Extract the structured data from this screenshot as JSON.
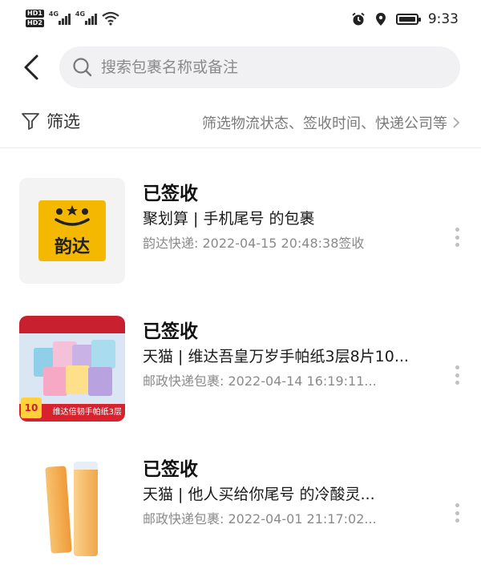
{
  "status_bar": {
    "hd1": "HD1",
    "hd2": "HD2",
    "net1": "4G",
    "net2": "4G",
    "time": "9:33",
    "battery_level": 0.85,
    "icons": [
      "alarm-icon",
      "location-icon",
      "battery-icon",
      "wifi-icon"
    ]
  },
  "search": {
    "placeholder": "搜索包裹名称或备注"
  },
  "filter": {
    "label": "筛选",
    "hint": "筛选物流状态、签收时间、快递公司等"
  },
  "packages": [
    {
      "status": "已签收",
      "description": "聚划算 | 手机尾号 的包裹",
      "meta": "韵达快递: 2022-04-15 20:48:38签收",
      "thumb_text": "韵达"
    },
    {
      "status": "已签收",
      "description": "天猫 | 维达吾皇万岁手帕纸3层8片10...",
      "meta": "邮政快递包裹: 2022-04-14 16:19:11...",
      "thumb_badge": "10",
      "thumb_banner": "维达倍韧手帕纸3层"
    },
    {
      "status": "已签收",
      "description": "天猫 | 他人买给你尾号 的冷酸灵...",
      "meta": "邮政快递包裹: 2022-04-01 21:17:02..."
    }
  ],
  "colors": {
    "yunda_brand": "#f5b800",
    "tissue_red": "#d8232f",
    "paste_orange": "#f0a64a"
  }
}
